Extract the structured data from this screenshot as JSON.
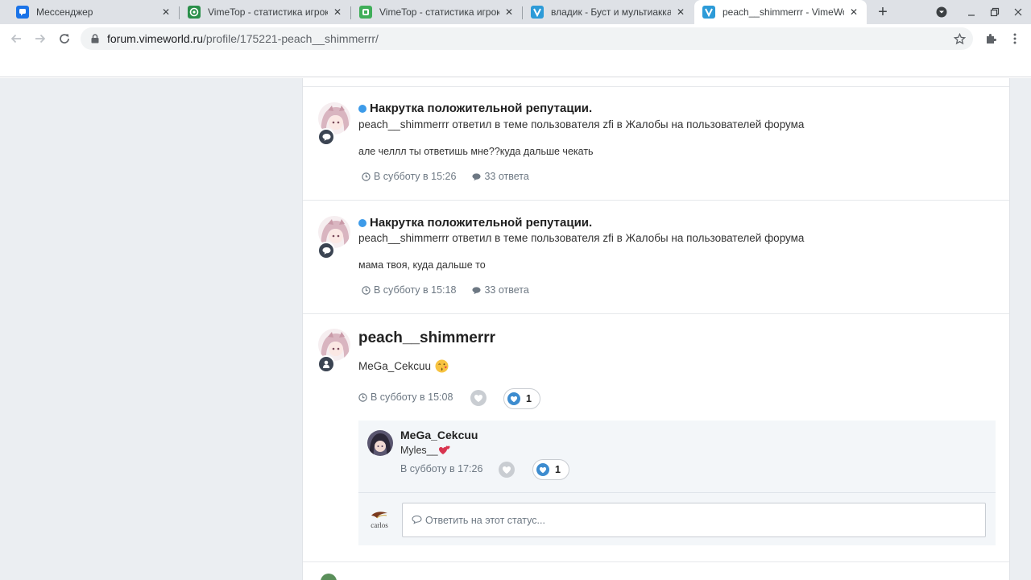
{
  "browser": {
    "tabs": [
      {
        "title": "Мессенджер",
        "favicon": "messenger-icon",
        "active": false
      },
      {
        "title": "VimeTop - статистика игроков",
        "favicon": "vimetop-icon",
        "active": false
      },
      {
        "title": "VimeTop - статистика игроков",
        "favicon": "vimetop-icon",
        "active": false
      },
      {
        "title": "владик - Буст и мультиаккаунт",
        "favicon": "vimeworld-icon",
        "active": false
      },
      {
        "title": "peach__shimmerrr - VimeWorld",
        "favicon": "vimeworld-icon",
        "active": true
      }
    ],
    "new_tab_symbol": "+",
    "address": {
      "host": "forum.vimeworld.ru",
      "path": "/profile/175221-peach__shimmerrr/"
    }
  },
  "feed": {
    "items": [
      {
        "title": "Накрутка положительной репутации.",
        "summary": "peach__shimmerrr ответил в теме пользователя zfi в Жалобы на пользователей форума",
        "text": "але челлл ты ответишь мне??куда дальше чекать",
        "time": "В субботу в 15:26",
        "replies": "33 ответа"
      },
      {
        "title": "Накрутка положительной репутации.",
        "summary": "peach__shimmerrr ответил в теме пользователя zfi в Жалобы на пользователей форума",
        "text": "мама твоя, куда дальше то",
        "time": "В субботу в 15:18",
        "replies": "33 ответа"
      }
    ],
    "status": {
      "author": "peach__shimmerrr",
      "text": "MeGa_Cekcuu",
      "emoji": "kissing-face-emoji",
      "time": "В субботу в 15:08",
      "reaction_count": "1",
      "comment": {
        "author": "MeGa_Cekcuu",
        "text": "Myles__",
        "emoji": "two-hearts-emoji",
        "time": "В субботу в 17:26",
        "reaction_count": "1"
      },
      "reply_placeholder": "Ответить на этот статус...",
      "reply_avatar_label": "carlos"
    }
  },
  "colors": {
    "accent": "#3d9be9",
    "badge": "#3b4452",
    "page_bg": "#ebeef2",
    "reaction_blue": "#3d8ccf"
  }
}
